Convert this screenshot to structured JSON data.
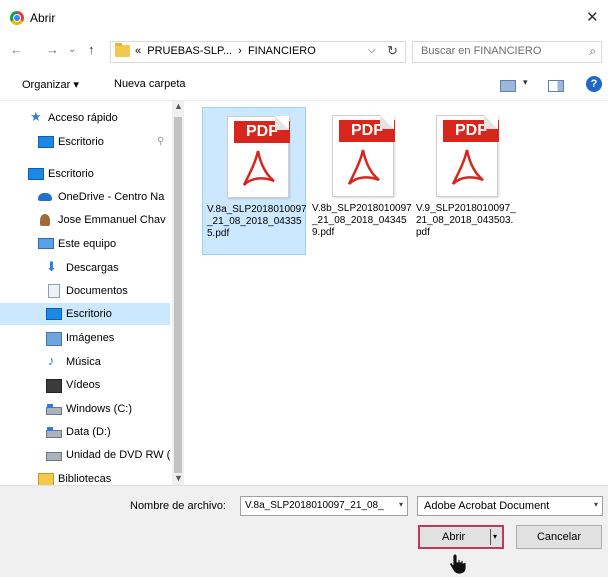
{
  "window": {
    "title": "Abrir",
    "close_glyph": "✕"
  },
  "nav": {
    "back": "←",
    "forward": "→",
    "recent": "⌄",
    "up": "↑"
  },
  "address": {
    "crumb_prefix": "«",
    "crumb_1": "PRUEBAS-SLP...",
    "separator": "›",
    "crumb_2": "FINANCIERO",
    "dropdown": "⌵",
    "refresh": "↻"
  },
  "search": {
    "placeholder": "Buscar en FINANCIERO",
    "icon": "⌕"
  },
  "toolbar": {
    "organize": "Organizar ▾",
    "new_folder": "Nueva carpeta",
    "view_dd": "▾",
    "help": "?"
  },
  "sidebar": {
    "items": [
      {
        "label": "Acceso rápido",
        "icon": "star-icon"
      },
      {
        "label": "Escritorio",
        "icon": "desktop-icon",
        "pinned": true
      },
      {
        "label": "Escritorio",
        "icon": "desktop-icon"
      },
      {
        "label": "OneDrive - Centro Na",
        "icon": "onedrive-icon"
      },
      {
        "label": "Jose Emmanuel Chav",
        "icon": "user-icon"
      },
      {
        "label": "Este equipo",
        "icon": "computer-icon"
      },
      {
        "label": "Descargas",
        "icon": "download-icon"
      },
      {
        "label": "Documentos",
        "icon": "documents-icon"
      },
      {
        "label": "Escritorio",
        "icon": "desktop-icon",
        "selected": true
      },
      {
        "label": "Imágenes",
        "icon": "pictures-icon"
      },
      {
        "label": "Música",
        "icon": "music-icon"
      },
      {
        "label": "Vídeos",
        "icon": "videos-icon"
      },
      {
        "label": "Windows (C:)",
        "icon": "drive-icon"
      },
      {
        "label": "Data (D:)",
        "icon": "drive-icon"
      },
      {
        "label": "Unidad de DVD RW (",
        "icon": "dvd-icon"
      },
      {
        "label": "Bibliotecas",
        "icon": "libraries-icon"
      }
    ],
    "pin_glyph": "📌"
  },
  "files": [
    {
      "name": "V.8a_SLP2018010097_21_08_2018_043355.pdf",
      "badge": "PDF",
      "selected": true
    },
    {
      "name": "V.8b_SLP2018010097_21_08_2018_043459.pdf",
      "badge": "PDF",
      "selected": false
    },
    {
      "name": "V.9_SLP2018010097_21_08_2018_043503.pdf",
      "badge": "PDF",
      "selected": false
    }
  ],
  "footer": {
    "filename_label": "Nombre de archivo:",
    "filename_value": "V.8a_SLP2018010097_21_08_",
    "filetype_value": "Adobe Acrobat Document",
    "open_label": "Abrir",
    "cancel_label": "Cancelar",
    "dd_glyph": "▾"
  },
  "colors": {
    "selection": "#cce8ff",
    "pdf_red": "#d9261c",
    "open_button_border": "#c0385c",
    "footer_bg": "#f0f0f0"
  }
}
